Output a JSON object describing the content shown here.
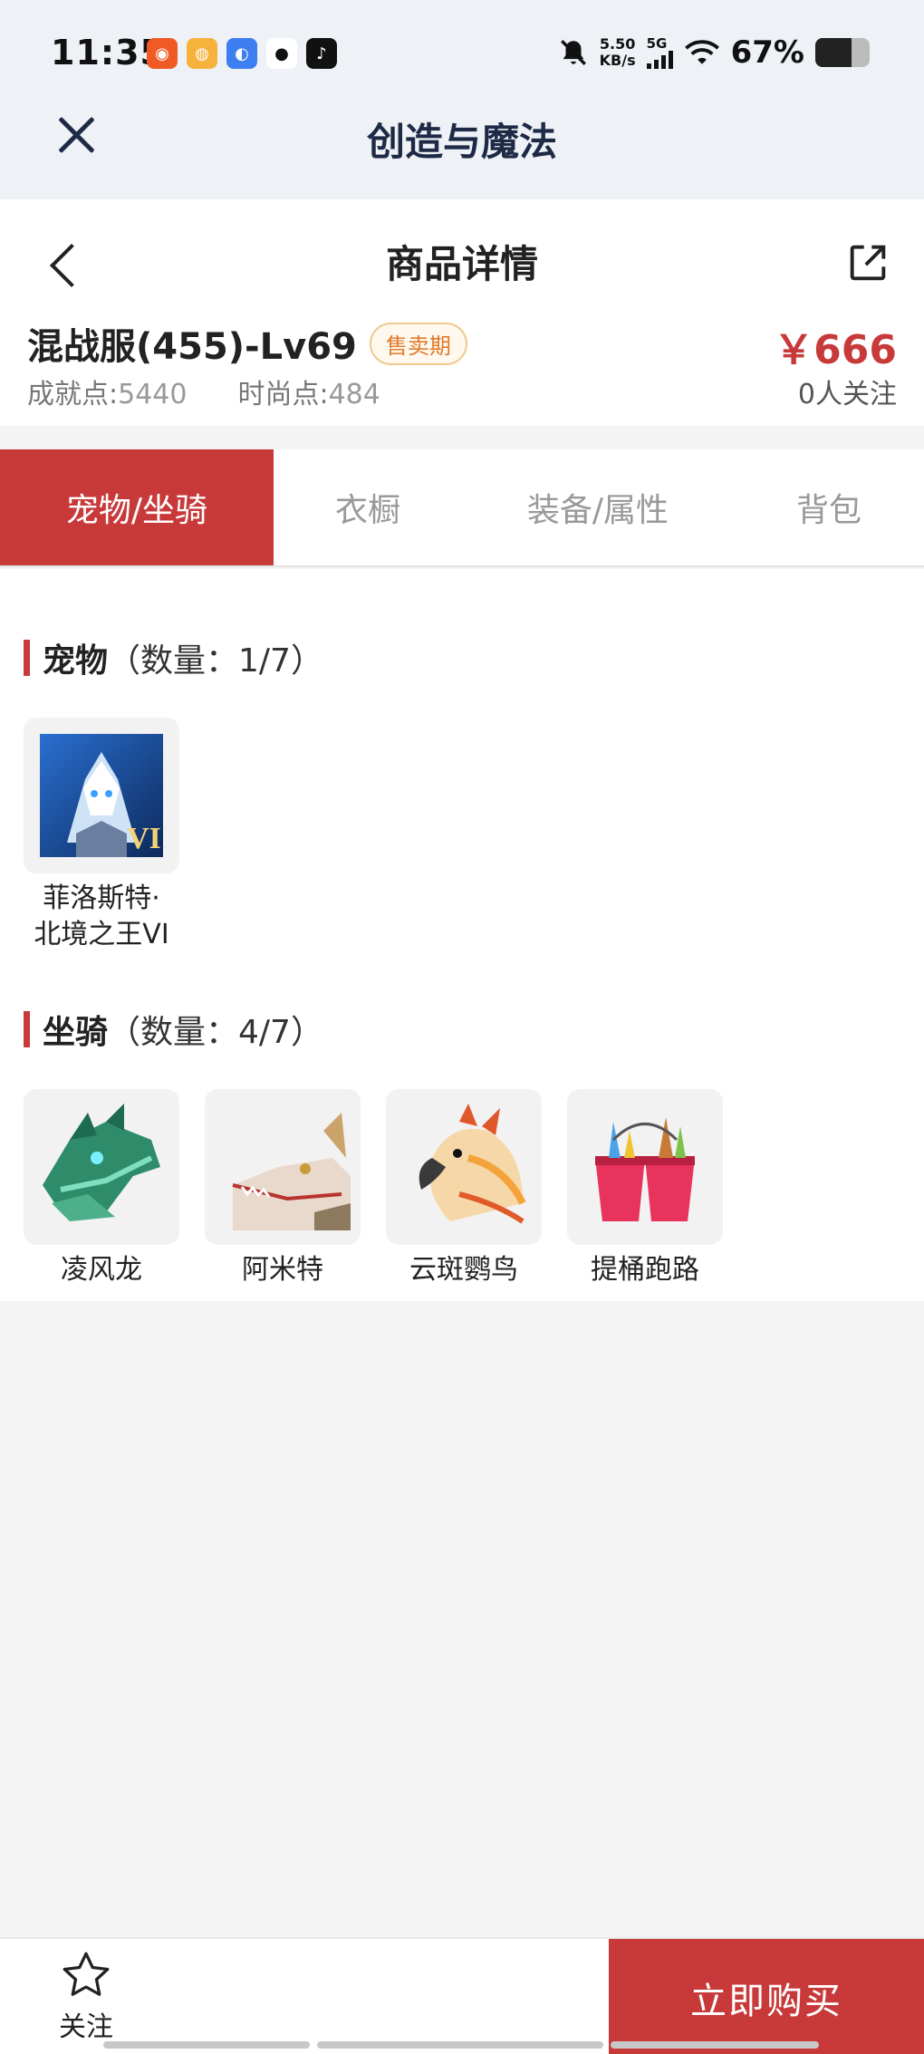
{
  "status_bar": {
    "time": "11:35",
    "apps": [
      {
        "icon": "kuaishou-app-icon",
        "color": "#f05a24",
        "glyph": "◉"
      },
      {
        "icon": "weibo-app-icon",
        "color": "#f6b23b",
        "glyph": "◍"
      },
      {
        "icon": "browser-app-icon",
        "color": "#3d7ff0",
        "glyph": "◐"
      },
      {
        "icon": "qq-app-icon",
        "color": "#ffffff",
        "glyph": "●"
      },
      {
        "icon": "tiktok-app-icon",
        "color": "#111111",
        "glyph": "♪"
      }
    ],
    "net_speed_value": "5.50",
    "net_speed_unit": "KB/s",
    "network": "5G",
    "battery_text": "67%",
    "battery_level": 0.67
  },
  "window": {
    "title": "创造与魔法"
  },
  "header": {
    "title": "商品详情",
    "product_name": "混战服(455)-Lv69",
    "badge": "售卖期",
    "achievement_label": "成就点:",
    "achievement_value": "5440",
    "fashion_label": "时尚点:",
    "fashion_value": "484",
    "price": "￥666",
    "followers": "0人关注"
  },
  "tabs": [
    {
      "label": "宠物/坐骑",
      "active": true
    },
    {
      "label": "衣橱",
      "active": false
    },
    {
      "label": "装备/属性",
      "active": false
    },
    {
      "label": "背包",
      "active": false
    }
  ],
  "pets": {
    "title": "宠物",
    "count": "（数量：1/7）",
    "items": [
      {
        "name": "菲洛斯特·\n北境之王VI",
        "line1": "菲洛斯特·",
        "line2": "北境之王VI",
        "badge": "VI"
      }
    ]
  },
  "mounts": {
    "title": "坐骑",
    "count": "（数量：4/7）",
    "items": [
      {
        "name": "凌风龙"
      },
      {
        "name": "阿米特"
      },
      {
        "name": "云斑鹦鸟"
      },
      {
        "name": "提桶跑路"
      }
    ]
  },
  "bottom": {
    "follow_label": "关注",
    "buy_label": "立即购买"
  },
  "colors": {
    "accent": "#c8393a",
    "badge": "#e07a2a"
  }
}
